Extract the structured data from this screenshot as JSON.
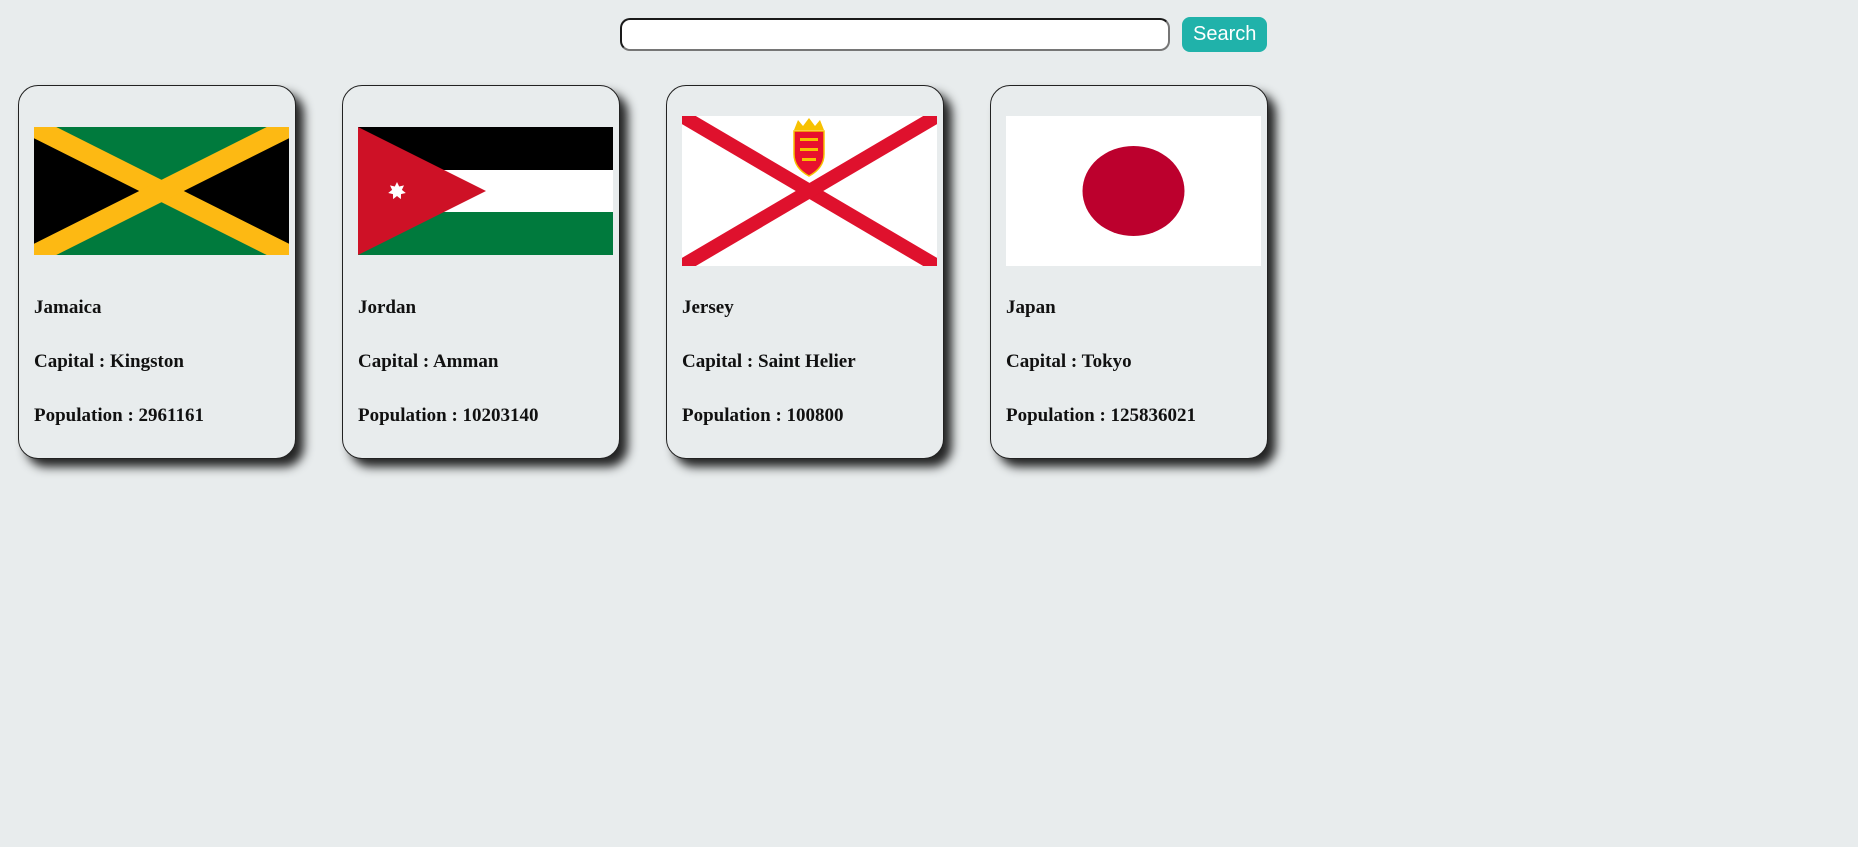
{
  "search": {
    "value": "",
    "button_label": "Search"
  },
  "countries": [
    {
      "name": "Jamaica",
      "capital": "Capital : Kingston",
      "population": "Population : 2961161",
      "flag_icon": "jamaica-flag-icon"
    },
    {
      "name": "Jordan",
      "capital": "Capital : Amman",
      "population": "Population : 10203140",
      "flag_icon": "jordan-flag-icon"
    },
    {
      "name": "Jersey",
      "capital": "Capital : Saint Helier",
      "population": "Population : 100800",
      "flag_icon": "jersey-flag-icon"
    },
    {
      "name": "Japan",
      "capital": "Capital : Tokyo",
      "population": "Population : 125836021",
      "flag_icon": "japan-flag-icon"
    }
  ],
  "colors": {
    "background": "#e8eced",
    "search_button": "#20b2aa"
  }
}
